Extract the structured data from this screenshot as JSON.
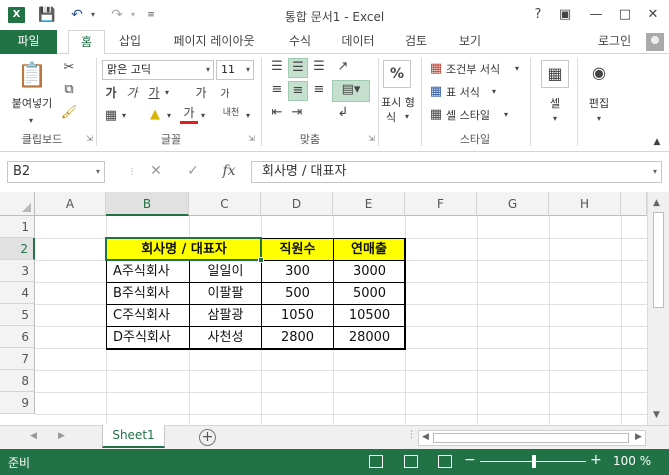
{
  "window": {
    "title": "통합 문서1 - Excel",
    "app_icon": "X",
    "help": "?",
    "minimize": "—",
    "close": "✕"
  },
  "ribbon_tabs": [
    {
      "label": "파일"
    },
    {
      "label": "홈"
    },
    {
      "label": "삽입"
    },
    {
      "label": "페이지 레이아웃"
    },
    {
      "label": "수식"
    },
    {
      "label": "데이터"
    },
    {
      "label": "검토"
    },
    {
      "label": "보기"
    }
  ],
  "signin": "로그인",
  "ribbon": {
    "clipboard": {
      "paste_label": "붙여넣기",
      "group_label": "클립보드"
    },
    "font": {
      "font_name": "맑은 고딕",
      "font_size": "11",
      "group_label": "글꼴",
      "bold": "가",
      "italic": "가",
      "underline": "가",
      "grow": "가",
      "shrink": "가",
      "font_color_glyph": "가",
      "phonetic": "내천"
    },
    "alignment": {
      "group_label": "맞춤"
    },
    "number": {
      "big_label": "%",
      "label_line1": "표시 형",
      "label_line2": "식",
      "group_label": ""
    },
    "styles": {
      "conditional": "조건부 서식",
      "table": "표 서식",
      "cell_styles": "셀 스타일",
      "group_label": "스타일"
    },
    "cells": {
      "label": "셀"
    },
    "editing": {
      "label": "편집"
    }
  },
  "formula_bar": {
    "name_box": "B2",
    "cancel": "✕",
    "enter": "✓",
    "fx": "fx",
    "content": "회사명 / 대표자"
  },
  "grid": {
    "columns": [
      "A",
      "B",
      "C",
      "D",
      "E",
      "F",
      "G",
      "H"
    ],
    "rows": [
      "1",
      "2",
      "3",
      "4",
      "5",
      "6",
      "7",
      "8",
      "9"
    ],
    "table": {
      "headers": [
        "회사명 / 대표자",
        "직원수",
        "연매출"
      ],
      "rows": [
        [
          "A주식회사",
          "일일이",
          "300",
          "3000"
        ],
        [
          "B주식회사",
          "이팔팔",
          "500",
          "5000"
        ],
        [
          "C주식회사",
          "삼팔광",
          "1050",
          "10500"
        ],
        [
          "D주식회사",
          "사천성",
          "2800",
          "28000"
        ]
      ]
    }
  },
  "sheets": [
    {
      "name": "Sheet1"
    }
  ],
  "add_sheet": "+",
  "status": {
    "text": "준비",
    "zoom_minus": "−",
    "zoom_plus": "+",
    "zoom": "100 %"
  },
  "colors": {
    "brand": "#217346",
    "header_fill": "#ffff00"
  }
}
